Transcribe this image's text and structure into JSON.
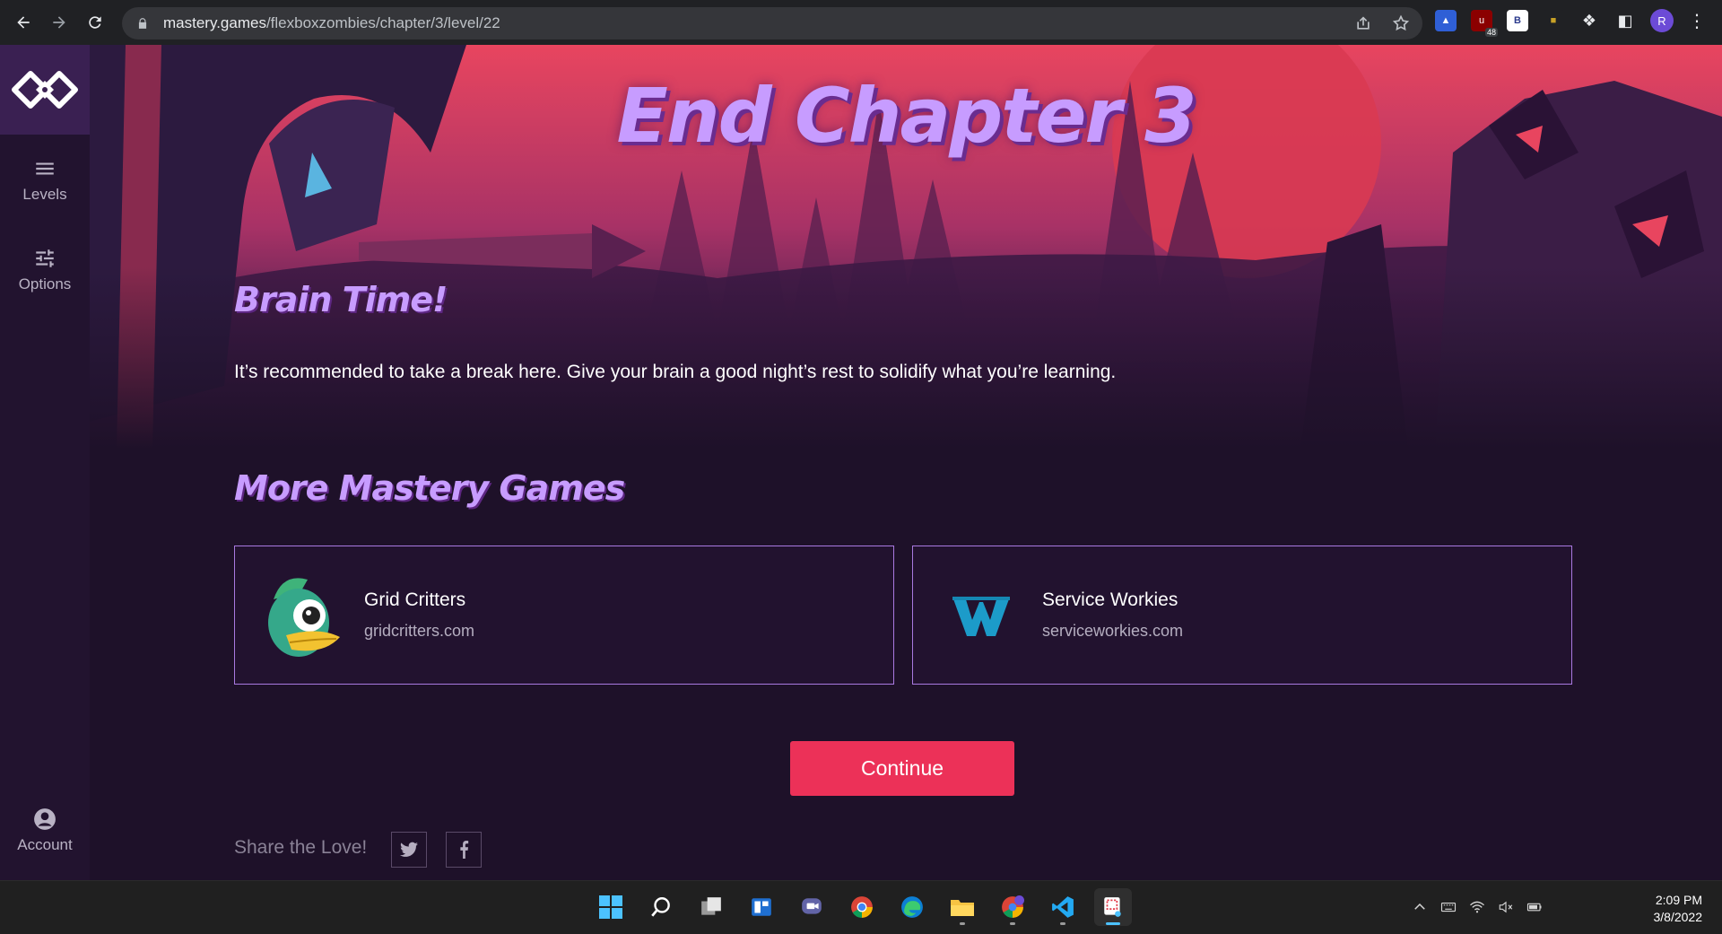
{
  "browser": {
    "url_host": "mastery.games",
    "url_path": "/flexboxzombies/chapter/3/level/22",
    "ext_badge": "48",
    "ext_b_label": "B",
    "profile_initial": "R"
  },
  "sidebar": {
    "levels_label": "Levels",
    "options_label": "Options",
    "account_label": "Account"
  },
  "main": {
    "chapter_title": "End Chapter 3",
    "brain_heading": "Brain Time!",
    "brain_text": "It’s recommended to take a break here. Give your brain a good night’s rest to solidify what you’re learning.",
    "more_heading": "More Mastery Games",
    "games": [
      {
        "title": "Grid Critters",
        "url": "gridcritters.com"
      },
      {
        "title": "Service Workies",
        "url": "serviceworkies.com"
      }
    ],
    "continue_label": "Continue",
    "share_label": "Share the Love!"
  },
  "taskbar": {
    "time": "2:09 PM",
    "date": "3/8/2022"
  },
  "colors": {
    "accent_pink": "#ec3158",
    "heading_purple": "#c79cff",
    "background": "#1e1129"
  }
}
